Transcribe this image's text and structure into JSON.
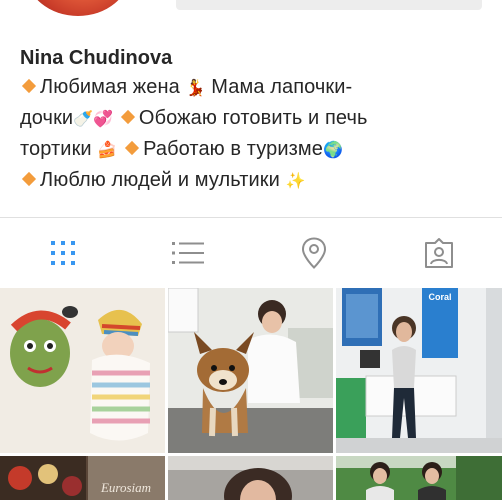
{
  "profile": {
    "name": "Nina Chudinova",
    "bio_lines": [
      {
        "text1": "Любимая жена",
        "emoji1": "💃",
        "text2": "Мама лапочки-"
      },
      {
        "text1": "дочки",
        "emoji1": "🍼💞",
        "text2": "Обожаю готовить и печь"
      },
      {
        "text1": "тортики",
        "emoji1": "🍰",
        "text2": "Работаю в туризме",
        "emoji2": "🌍"
      },
      {
        "text1": "Люблю людей и мультики",
        "emoji1": "✨"
      }
    ]
  },
  "tabs": [
    {
      "name": "grid",
      "icon": "grid-icon",
      "active": true
    },
    {
      "name": "list",
      "icon": "list-icon",
      "active": false
    },
    {
      "name": "location",
      "icon": "location-pin-icon",
      "active": false
    },
    {
      "name": "tagged",
      "icon": "tagged-user-icon",
      "active": false
    }
  ],
  "colors": {
    "active_tab": "#3897f0",
    "inactive_tab": "#8e8e8e",
    "bullet": "#f39c3c"
  },
  "photo_logo_text": "Coral",
  "photo_sign_text": "Eurosiam"
}
